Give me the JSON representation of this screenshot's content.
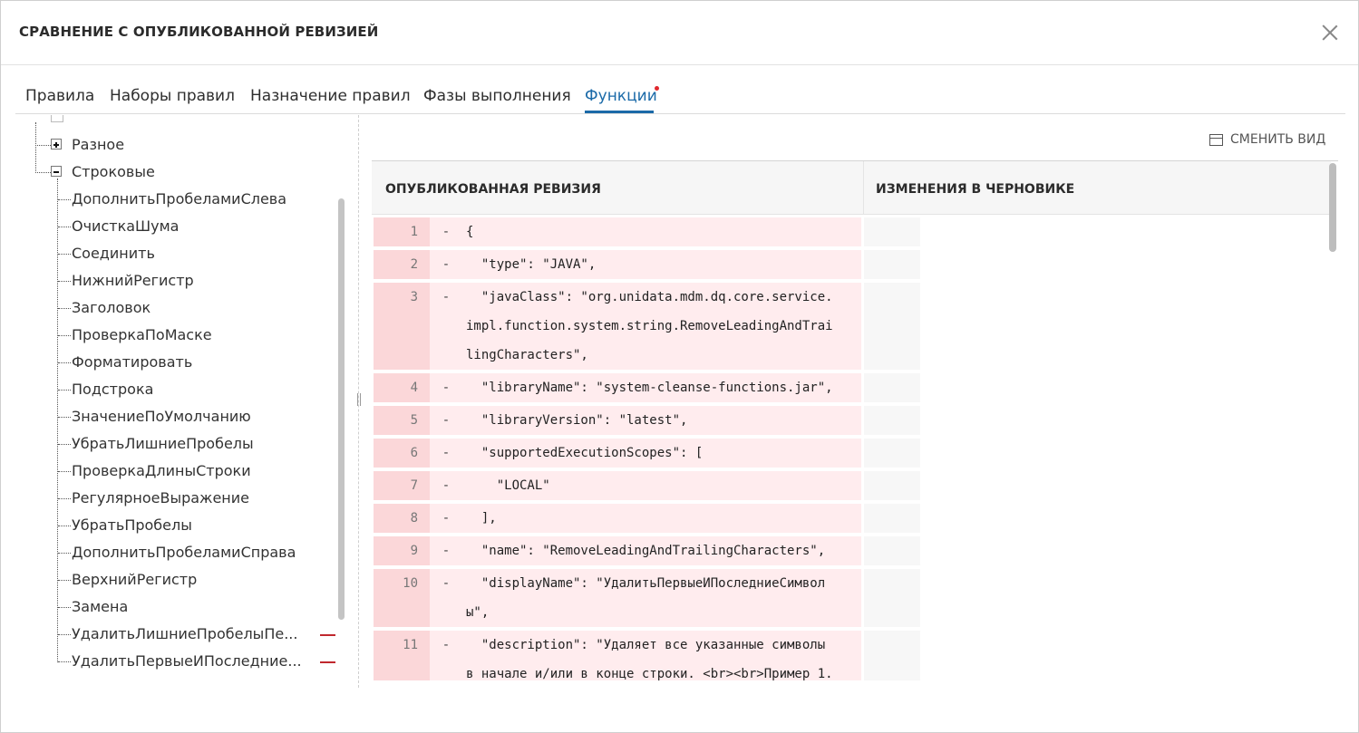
{
  "dialog": {
    "title": "СРАВНЕНИЕ С ОПУБЛИКОВАННОЙ РЕВИЗИЕЙ"
  },
  "tabs": [
    {
      "label": "Правила"
    },
    {
      "label": "Наборы правил"
    },
    {
      "label": "Назначение правил"
    },
    {
      "label": "Фазы выполнения"
    },
    {
      "label": "Функции"
    }
  ],
  "tree": {
    "groups": [
      {
        "label": "Разное",
        "state": "collapsed"
      },
      {
        "label": "Строковые",
        "state": "expanded"
      }
    ],
    "items": [
      {
        "label": "ДополнитьПробеламиСлева"
      },
      {
        "label": "ОчисткаШума"
      },
      {
        "label": "Соединить"
      },
      {
        "label": "НижнийРегистр"
      },
      {
        "label": "Заголовок"
      },
      {
        "label": "ПроверкаПоМаске"
      },
      {
        "label": "Форматировать"
      },
      {
        "label": "Подстрока"
      },
      {
        "label": "ЗначениеПоУмолчанию"
      },
      {
        "label": "УбратьЛишниеПробелы"
      },
      {
        "label": "ПроверкаДлиныСтроки"
      },
      {
        "label": "РегулярноеВыражение"
      },
      {
        "label": "УбратьПробелы"
      },
      {
        "label": "ДополнитьПробеламиСправа"
      },
      {
        "label": "ВерхнийРегистр"
      },
      {
        "label": "Замена"
      },
      {
        "label": "УдалитьЛишниеПробелыПе...",
        "removed": true
      },
      {
        "label": "УдалитьПервыеИПоследние...",
        "removed": true
      }
    ]
  },
  "toolbar": {
    "change_view_label": "СМЕНИТЬ ВИД"
  },
  "diff": {
    "left_header": "ОПУБЛИКОВАННАЯ РЕВИЗИЯ",
    "right_header": "ИЗМЕНЕНИЯ В ЧЕРНОВИКЕ",
    "removed_sign": "-",
    "lines": [
      {
        "num": "1",
        "text": [
          "{"
        ]
      },
      {
        "num": "2",
        "text": [
          "  \"type\": \"JAVA\","
        ]
      },
      {
        "num": "3",
        "text": [
          "  \"javaClass\": \"org.unidata.mdm.dq.core.service.",
          "impl.function.system.string.RemoveLeadingAndTrai",
          "lingCharacters\","
        ]
      },
      {
        "num": "4",
        "text": [
          "  \"libraryName\": \"system-cleanse-functions.jar\","
        ]
      },
      {
        "num": "5",
        "text": [
          "  \"libraryVersion\": \"latest\","
        ]
      },
      {
        "num": "6",
        "text": [
          "  \"supportedExecutionScopes\": ["
        ]
      },
      {
        "num": "7",
        "text": [
          "    \"LOCAL\""
        ]
      },
      {
        "num": "8",
        "text": [
          "  ],"
        ]
      },
      {
        "num": "9",
        "text": [
          "  \"name\": \"RemoveLeadingAndTrailingCharacters\","
        ]
      },
      {
        "num": "10",
        "text": [
          "  \"displayName\": \"УдалитьПервыеИПоследниеСимвол",
          "ы\","
        ]
      },
      {
        "num": "11",
        "text": [
          "  \"description\": \"Удаляет все указанные символы",
          "в начале и/или в конце строки. <br><br>Пример 1."
        ]
      }
    ]
  }
}
